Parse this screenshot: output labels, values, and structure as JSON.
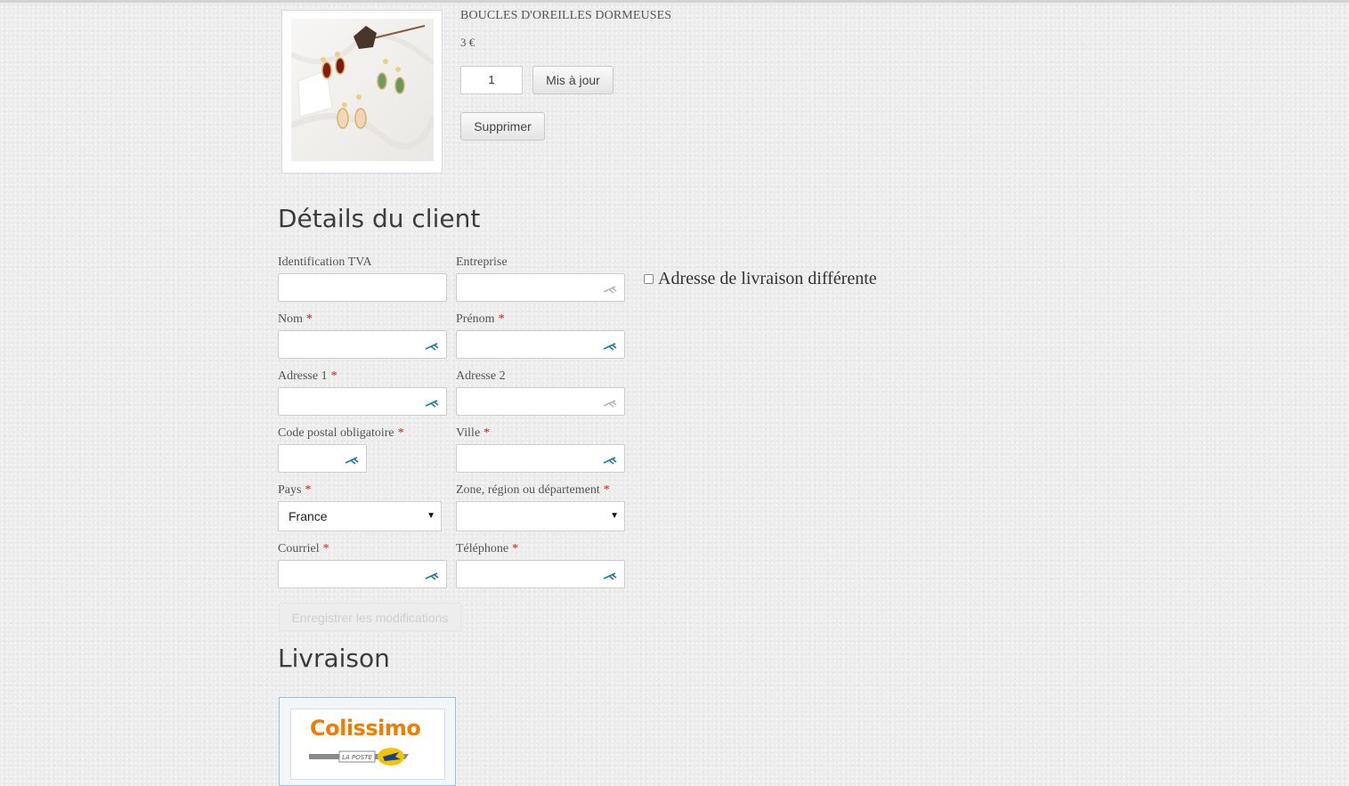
{
  "product": {
    "title": "BOUCLES D'OREILLES DORMEUSES",
    "price": "3 €",
    "quantity": "1",
    "update_label": "Mis à jour",
    "delete_label": "Supprimer"
  },
  "customer": {
    "heading": "Détails du client",
    "required_marker": "*",
    "fields": {
      "vat": {
        "label": "Identification TVA",
        "value": ""
      },
      "company": {
        "label": "Entreprise",
        "value": ""
      },
      "last_name": {
        "label": "Nom",
        "value": ""
      },
      "first_name": {
        "label": "Prénom",
        "value": ""
      },
      "address1": {
        "label": "Adresse 1",
        "value": ""
      },
      "address2": {
        "label": "Adresse 2",
        "value": ""
      },
      "postcode": {
        "label": "Code postal obligatoire",
        "value": ""
      },
      "city": {
        "label": "Ville",
        "value": ""
      },
      "country": {
        "label": "Pays",
        "value": "France"
      },
      "zone": {
        "label": "Zone, région ou département",
        "value": ""
      },
      "email": {
        "label": "Courriel",
        "value": ""
      },
      "phone": {
        "label": "Téléphone",
        "value": ""
      }
    },
    "different_shipping_label": "Adresse de livraison différente",
    "save_label": "Enregistrer les modifications"
  },
  "shipping": {
    "heading": "Livraison",
    "carrier_logo_text": "Colissimo",
    "carrier_logo_subtext": "LA POSTE"
  },
  "colors": {
    "required": "#dd1111",
    "autofill_hint_active": "#1a7f95",
    "autofill_hint_inactive": "#b5b5b5",
    "colissimo_orange": "#f07d00",
    "card_border": "#9bbdd6"
  }
}
